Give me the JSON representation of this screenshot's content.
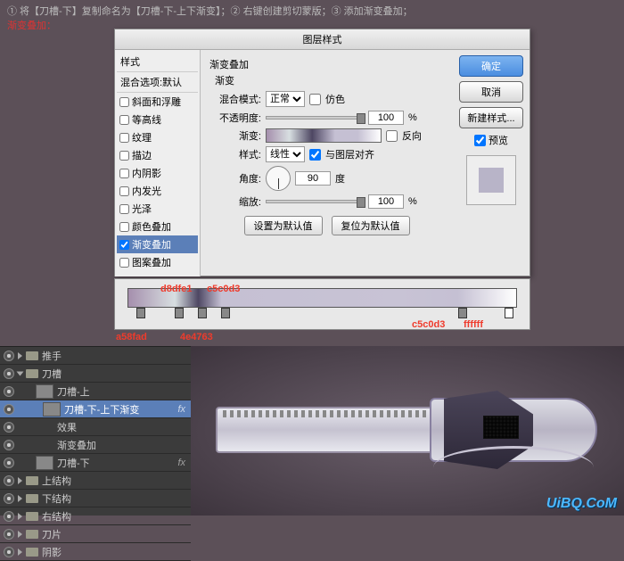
{
  "instructions": {
    "line1_a": "① 将【刀槽-下】复制命名为【刀槽-下-上下渐变】；② 右键创建剪切蒙版；③ 添加渐变叠加；",
    "line2": "渐变叠加："
  },
  "dialog": {
    "title": "图层样式",
    "style_header": "样式",
    "blending_default": "混合选项:默认",
    "items": [
      "斜面和浮雕",
      "等高线",
      "纹理",
      "描边",
      "内阴影",
      "内发光",
      "光泽",
      "颜色叠加",
      "渐变叠加",
      "图案叠加"
    ],
    "selected_index": 8,
    "panel_title": "渐变叠加",
    "panel_sub": "渐变",
    "blend_mode_label": "混合模式:",
    "blend_mode_value": "正常",
    "dither_label": "仿色",
    "opacity_label": "不透明度:",
    "opacity_value": "100",
    "pct": "%",
    "gradient_label": "渐变:",
    "reverse_label": "反向",
    "style_label": "样式:",
    "style_value": "线性",
    "align_label": "与图层对齐",
    "angle_label": "角度:",
    "angle_value": "90",
    "degree": "度",
    "scale_label": "缩放:",
    "scale_value": "100",
    "set_default": "设置为默认值",
    "reset_default": "复位为默认值",
    "ok": "确定",
    "cancel": "取消",
    "new_style": "新建样式...",
    "preview_label": "预览"
  },
  "gradient_stops": {
    "s1": "a58fad",
    "s2": "d8dfe1",
    "s3": "4e4763",
    "s4": "c5c0d3",
    "s5": "c5c0d3",
    "s6": "ffffff"
  },
  "layers_panel": {
    "items": [
      {
        "name": "推手",
        "type": "folder"
      },
      {
        "name": "刀槽",
        "type": "folder",
        "open": true
      },
      {
        "name": "刀槽-上",
        "type": "layer"
      },
      {
        "name": "刀槽-下-上下渐变",
        "type": "layer",
        "sel": true,
        "fx": "fx"
      },
      {
        "name": "效果",
        "type": "fx"
      },
      {
        "name": "渐变叠加",
        "type": "fx"
      },
      {
        "name": "刀槽-下",
        "type": "layer",
        "fx": "fx"
      },
      {
        "name": "上结构",
        "type": "folder"
      },
      {
        "name": "下结构",
        "type": "folder"
      },
      {
        "name": "右结构",
        "type": "folder"
      },
      {
        "name": "刀片",
        "type": "folder"
      },
      {
        "name": "阴影",
        "type": "folder"
      }
    ]
  },
  "watermark": "UiBQ.CoM"
}
